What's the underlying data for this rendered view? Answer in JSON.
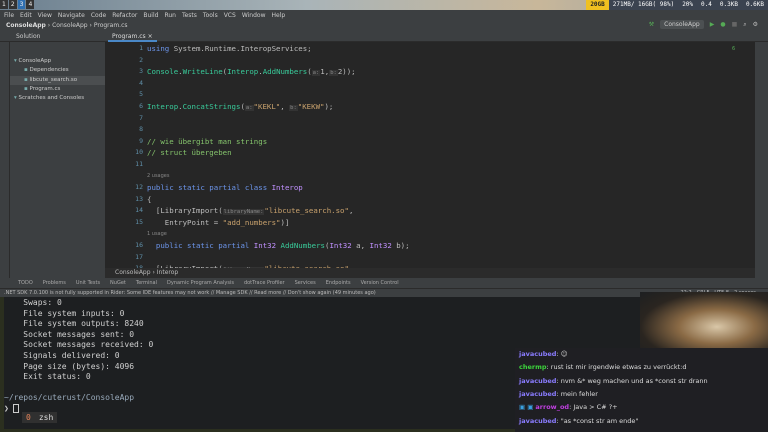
{
  "topbar": {
    "workspaces": [
      "1",
      "2",
      "3",
      "4"
    ],
    "active_workspace": "3",
    "stats": {
      "disk": "20GB",
      "memory": "271MB/ 16GB( 98%)",
      "cpu": "20%",
      "load": "0.4",
      "net_up": "0.3KB",
      "net_down": "0.6KB"
    }
  },
  "menu": [
    "File",
    "Edit",
    "View",
    "Navigate",
    "Code",
    "Refactor",
    "Build",
    "Run",
    "Tests",
    "Tools",
    "VCS",
    "Window",
    "Help"
  ],
  "breadcrumb": [
    "ConsoleApp",
    "ConsoleApp",
    "Program.cs"
  ],
  "run_config": "ConsoleApp",
  "sidebar": {
    "title": "Solution",
    "items": [
      {
        "label": "ConsoleApp",
        "depth": 0,
        "icon": "solution-icon"
      },
      {
        "label": "Dependencies",
        "depth": 1,
        "icon": "dependencies-icon"
      },
      {
        "label": "libcute_search.so",
        "depth": 1,
        "icon": "file-icon",
        "selected": true
      },
      {
        "label": "Program.cs",
        "depth": 1,
        "icon": "csharp-file-icon"
      },
      {
        "label": "Scratches and Consoles",
        "depth": 0,
        "icon": "scratches-icon"
      }
    ]
  },
  "editor": {
    "tab": "Program.cs",
    "warnings": "6",
    "lines": [
      {
        "n": "1",
        "tokens": [
          [
            "kw",
            "using"
          ],
          [
            "pl",
            " System.Runtime.InteropServices;"
          ]
        ]
      },
      {
        "n": "2",
        "tokens": []
      },
      {
        "n": "3",
        "tokens": [
          [
            "fn",
            "Console"
          ],
          [
            "pl",
            "."
          ],
          [
            "fn",
            "WriteLine"
          ],
          [
            "pl",
            "("
          ],
          [
            "fn",
            "Interop"
          ],
          [
            "pl",
            "."
          ],
          [
            "fn",
            "AddNumbers"
          ],
          [
            "pl",
            "("
          ],
          [
            "ih",
            "a:"
          ],
          [
            "pl",
            "1,"
          ],
          [
            "ih",
            "b:"
          ],
          [
            "pl",
            "2));"
          ]
        ]
      },
      {
        "n": "4",
        "tokens": []
      },
      {
        "n": "5",
        "tokens": []
      },
      {
        "n": "6",
        "tokens": [
          [
            "fn",
            "Interop"
          ],
          [
            "pl",
            "."
          ],
          [
            "fn",
            "ConcatStrings"
          ],
          [
            "pl",
            "("
          ],
          [
            "ih",
            "a:"
          ],
          [
            "st",
            "\"KEKL\""
          ],
          [
            "pl",
            ", "
          ],
          [
            "ih",
            "b:"
          ],
          [
            "st",
            "\"KEKW\""
          ],
          [
            "pl",
            ");"
          ]
        ]
      },
      {
        "n": "7",
        "tokens": []
      },
      {
        "n": "8",
        "tokens": []
      },
      {
        "n": "9",
        "tokens": [
          [
            "cm",
            "// wie übergibt man strings"
          ]
        ]
      },
      {
        "n": "10",
        "tokens": [
          [
            "cm",
            "// struct übergeben"
          ]
        ]
      },
      {
        "n": "11",
        "tokens": []
      },
      {
        "hint": "2 usages"
      },
      {
        "n": "12",
        "tokens": [
          [
            "kw",
            "public static partial class "
          ],
          [
            "cl",
            "Interop"
          ]
        ]
      },
      {
        "n": "13",
        "tokens": [
          [
            "pl",
            "{"
          ]
        ]
      },
      {
        "n": "14",
        "tokens": [
          [
            "pl",
            "  [LibraryImport("
          ],
          [
            "ih",
            "libraryName:"
          ],
          [
            "st",
            "\"libcute_search.so\""
          ],
          [
            "pl",
            ","
          ]
        ]
      },
      {
        "n": "15",
        "tokens": [
          [
            "pl",
            "    EntryPoint = "
          ],
          [
            "st",
            "\"add_numbers\""
          ],
          [
            "pl",
            ")]"
          ]
        ]
      },
      {
        "hint": "1 usage"
      },
      {
        "n": "16",
        "tokens": [
          [
            "kw",
            "  public static partial "
          ],
          [
            "ty",
            "Int32"
          ],
          [
            "pl",
            " "
          ],
          [
            "fn",
            "AddNumbers"
          ],
          [
            "pl",
            "("
          ],
          [
            "ty",
            "Int32"
          ],
          [
            "pl",
            " a, "
          ],
          [
            "ty",
            "Int32"
          ],
          [
            "pl",
            " b);"
          ]
        ]
      },
      {
        "n": "17",
        "tokens": []
      },
      {
        "n": "18",
        "tokens": [
          [
            "pl",
            "  [LibraryImport("
          ],
          [
            "ih",
            "libraryName:"
          ],
          [
            "st",
            "\"libcute_search.so\""
          ]
        ]
      }
    ],
    "crumbs": [
      "ConsoleApp",
      "Interop"
    ]
  },
  "toolwindows": [
    "TODO",
    "Problems",
    "Unit Tests",
    "NuGet",
    "Terminal",
    "Dynamic Program Analysis",
    "dotTrace Profiler",
    "Services",
    "Endpoints",
    "Version Control"
  ],
  "status": {
    "message": ".NET SDK 7.0.100 is not fully supported in Rider: Some IDE features may not work // Manage SDK // Read more // Don't show again (49 minutes ago)",
    "position": "22:2",
    "line_ending": "CRLF",
    "encoding": "UTF-8",
    "indent": "2 spaces"
  },
  "terminal": {
    "lines": [
      "    Swaps: 0",
      "    File system inputs: 0",
      "    File system outputs: 8240",
      "    Socket messages sent: 0",
      "    Socket messages received: 0",
      "    Signals delivered: 0",
      "    Page size (bytes): 4096",
      "    Exit status: 0",
      "",
      "~/repos/cuterust/ConsoleApp"
    ],
    "prompt": "❯",
    "tmux_index": "0",
    "tmux_window": "zsh"
  },
  "chat": [
    {
      "user": "javacubed",
      "color": "#8a7cff",
      "text": "☺"
    },
    {
      "user": "chermp",
      "color": "#3cd43c",
      "text": "rust ist mir irgendwie etwas zu verrückt:d"
    },
    {
      "user": "javacubed",
      "color": "#8a7cff",
      "text": "nvm &* weg machen und as *const str drann"
    },
    {
      "user": "javacubed",
      "color": "#8a7cff",
      "text": "mein fehler"
    },
    {
      "user": "arrow_od",
      "color": "#c040e0",
      "text": "Java > C# ?+",
      "badges": true
    },
    {
      "user": "javacubed",
      "color": "#8a7cff",
      "text": "\"as *const str am ende\""
    }
  ]
}
